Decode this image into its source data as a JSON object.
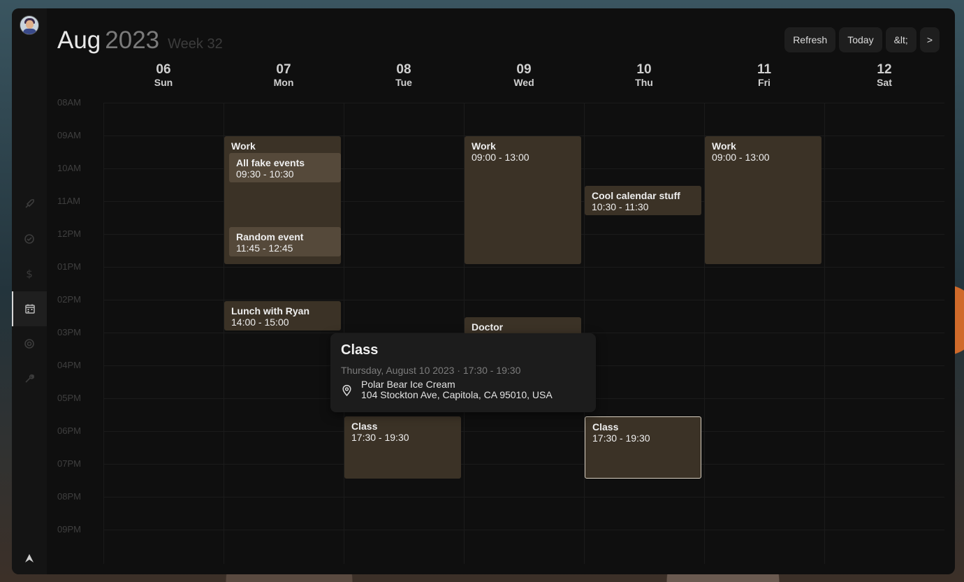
{
  "header": {
    "month": "Aug",
    "year": "2023",
    "week": "Week 32",
    "buttons": {
      "refresh": "Refresh",
      "today": "Today",
      "prev": "&lt;",
      "next": ">"
    }
  },
  "days": [
    {
      "num": "06",
      "name": "Sun"
    },
    {
      "num": "07",
      "name": "Mon"
    },
    {
      "num": "08",
      "name": "Tue"
    },
    {
      "num": "09",
      "name": "Wed"
    },
    {
      "num": "10",
      "name": "Thu"
    },
    {
      "num": "11",
      "name": "Fri"
    },
    {
      "num": "12",
      "name": "Sat"
    }
  ],
  "time_labels": [
    "08AM",
    "09AM",
    "10AM",
    "11AM",
    "12PM",
    "01PM",
    "02PM",
    "03PM",
    "04PM",
    "05PM",
    "06PM",
    "07PM",
    "08PM",
    "09PM"
  ],
  "events": {
    "mon_work": {
      "title": "Work"
    },
    "mon_fake": {
      "title": "All fake events",
      "time": "09:30 - 10:30"
    },
    "mon_random": {
      "title": "Random event",
      "time": "11:45 - 12:45"
    },
    "mon_lunch": {
      "title": "Lunch with Ryan",
      "time": "14:00 - 15:00"
    },
    "tue_class": {
      "title": "Class",
      "time": "17:30 - 19:30"
    },
    "wed_work": {
      "title": "Work",
      "time": "09:00 - 13:00"
    },
    "wed_doctor": {
      "title": "Doctor"
    },
    "thu_cool": {
      "title": "Cool calendar stuff",
      "time": "10:30 - 11:30"
    },
    "thu_class": {
      "title": "Class",
      "time": "17:30 - 19:30"
    },
    "fri_work": {
      "title": "Work",
      "time": "09:00 - 13:00"
    }
  },
  "popup": {
    "title": "Class",
    "date": "Thursday, August 10 2023  ·  17:30 - 19:30",
    "location_name": "Polar Bear Ice Cream",
    "location_address": "104 Stockton Ave, Capitola, CA 95010, USA"
  },
  "sidebar": {
    "items": [
      "rocket-icon",
      "check-circle-icon",
      "dollar-icon",
      "calendar-icon",
      "target-icon",
      "wrench-icon"
    ],
    "bottom_icon": "app-logo-icon"
  }
}
